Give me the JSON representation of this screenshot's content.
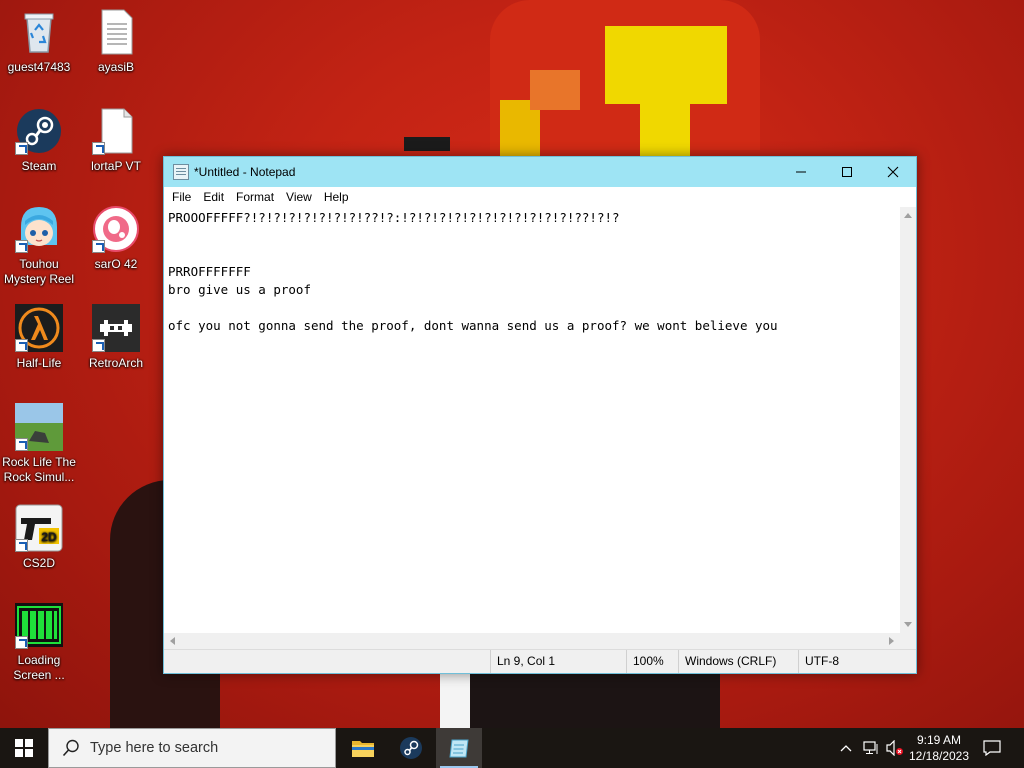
{
  "desktop": {
    "icons": [
      {
        "label": "guest47483",
        "icon": "recycle-bin-icon"
      },
      {
        "label": "ayasiB",
        "icon": "text-file-icon"
      },
      {
        "label": "Steam",
        "icon": "steam-icon"
      },
      {
        "label": "lortaP VT",
        "icon": "blank-file-icon"
      },
      {
        "label": "Touhou Mystery Reel",
        "icon": "touhou-character-icon"
      },
      {
        "label": "sarO 42",
        "icon": "osu-icon"
      },
      {
        "label": "Half-Life",
        "icon": "half-life-lambda-icon"
      },
      {
        "label": "RetroArch",
        "icon": "retroarch-invader-icon"
      },
      {
        "label": "Rock Life The Rock Simul...",
        "icon": "rock-life-landscape-icon"
      },
      {
        "label": "CS2D",
        "icon": "cs2d-pistol-icon"
      },
      {
        "label": "Loading Screen ...",
        "icon": "green-battery-icon"
      }
    ]
  },
  "notepad": {
    "title": "*Untitled - Notepad",
    "menu": [
      "File",
      "Edit",
      "Format",
      "View",
      "Help"
    ],
    "content": "PROOOFFFFF?!?!?!?!?!?!?!?!??!?:!?!?!?!?!?!?!?!?!?!?!?!??!?!?\n\n\nPRROFFFFFFF\nbro give us a proof\n\nofc you not gonna send the proof, dont wanna send us a proof? we wont believe you",
    "status": {
      "position": "Ln 9, Col 1",
      "zoom": "100%",
      "line_ending": "Windows (CRLF)",
      "encoding": "UTF-8"
    }
  },
  "taskbar": {
    "search_placeholder": "Type here to search",
    "apps": [
      {
        "name": "File Explorer",
        "icon": "folder-icon"
      },
      {
        "name": "Steam",
        "icon": "steam-icon"
      },
      {
        "name": "Notepad",
        "icon": "notepad-icon",
        "active": true
      }
    ],
    "clock": {
      "time": "9:19 AM",
      "date": "12/18/2023"
    }
  },
  "colors": {
    "title_bar": "#9ee4f4",
    "wallpaper_red": "#c22314",
    "taskbar": "#1a1612",
    "wallpaper_yellow": "#f0d800"
  }
}
